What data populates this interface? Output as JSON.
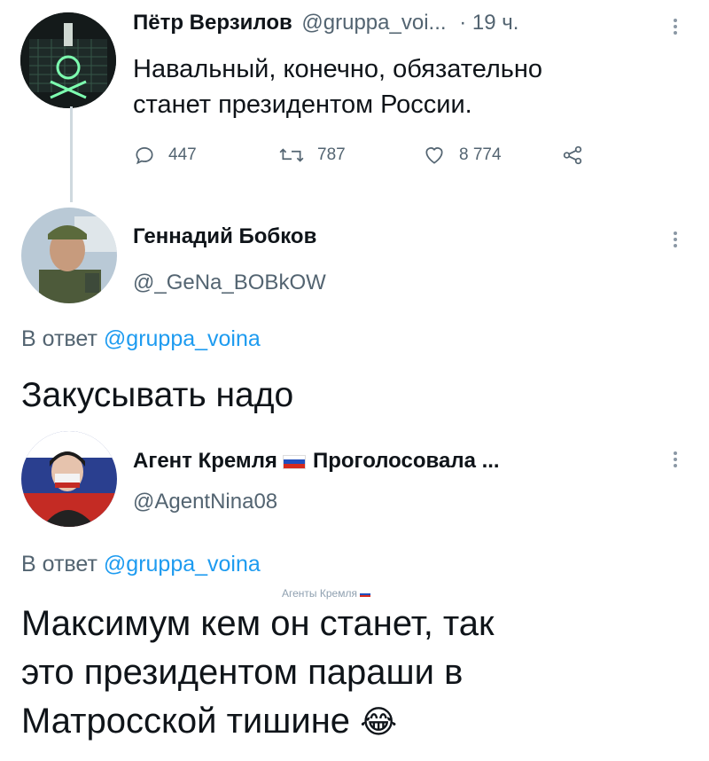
{
  "tweet1": {
    "name": "Пётр Верзилов",
    "handle": "@gruppa_voi...",
    "time": "· 19 ч.",
    "text_line1": "Навальный, конечно, обязательно",
    "text_line2": "станет президентом России.",
    "replies": "447",
    "retweets": "787",
    "likes": "8 774"
  },
  "tweet2": {
    "name": "Геннадий Бобков",
    "handle": "@_GeNa_BOBkOW",
    "reply_prefix": "В ответ",
    "reply_handle": "@gruppa_voina",
    "text": "Закусывать надо"
  },
  "tweet3": {
    "name_part1": "Агент Кремля",
    "name_part2": "Проголосовала ...",
    "handle": "@AgentNina08",
    "reply_prefix": "В ответ",
    "reply_handle": "@gruppa_voina",
    "text_line1": "Максимум кем он станет, так",
    "text_line2": "это президентом параши в",
    "text_line3": "Матросской тишине",
    "emoji": "😂"
  },
  "watermark": "Агенты Кремля",
  "colors": {
    "text": "#0f1419",
    "muted": "#536471",
    "link": "#1d9bf0",
    "flag_white": "#ffffff",
    "flag_blue": "#1f4fbf",
    "flag_red": "#d52b1e"
  },
  "icons": [
    "reply-icon",
    "retweet-icon",
    "like-icon",
    "share-icon",
    "more-icon"
  ]
}
